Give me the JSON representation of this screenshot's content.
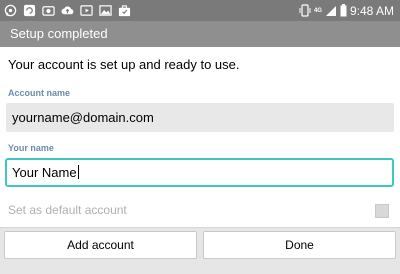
{
  "status_bar": {
    "time": "9:48 AM",
    "network_badge": "4G",
    "left_icons": [
      "whatsapp-icon",
      "sync-icon",
      "camera-icon",
      "cloud-upload-icon",
      "video-icon",
      "image-icon",
      "briefcase-icon"
    ],
    "right_icons": [
      "vibrate-icon",
      "signal-icon",
      "battery-icon"
    ]
  },
  "header": {
    "title": "Setup completed"
  },
  "main": {
    "intro": "Your account is set up and ready to use.",
    "account_name": {
      "label": "Account name",
      "value": "yourname@domain.com"
    },
    "your_name": {
      "label": "Your name",
      "value": "Your Name"
    },
    "default_account": {
      "label": "Set as default account",
      "checked": true,
      "enabled": false
    }
  },
  "buttons": {
    "add_account": "Add account",
    "done": "Done"
  },
  "colors": {
    "status_bar": "#7a7a7a",
    "title_bar": "#8f8f8f",
    "label_blue": "#6b8cae",
    "focus_border": "#3ec6c0",
    "readonly_field": "#e8e8e8",
    "disabled_text": "#b0b0b0"
  }
}
